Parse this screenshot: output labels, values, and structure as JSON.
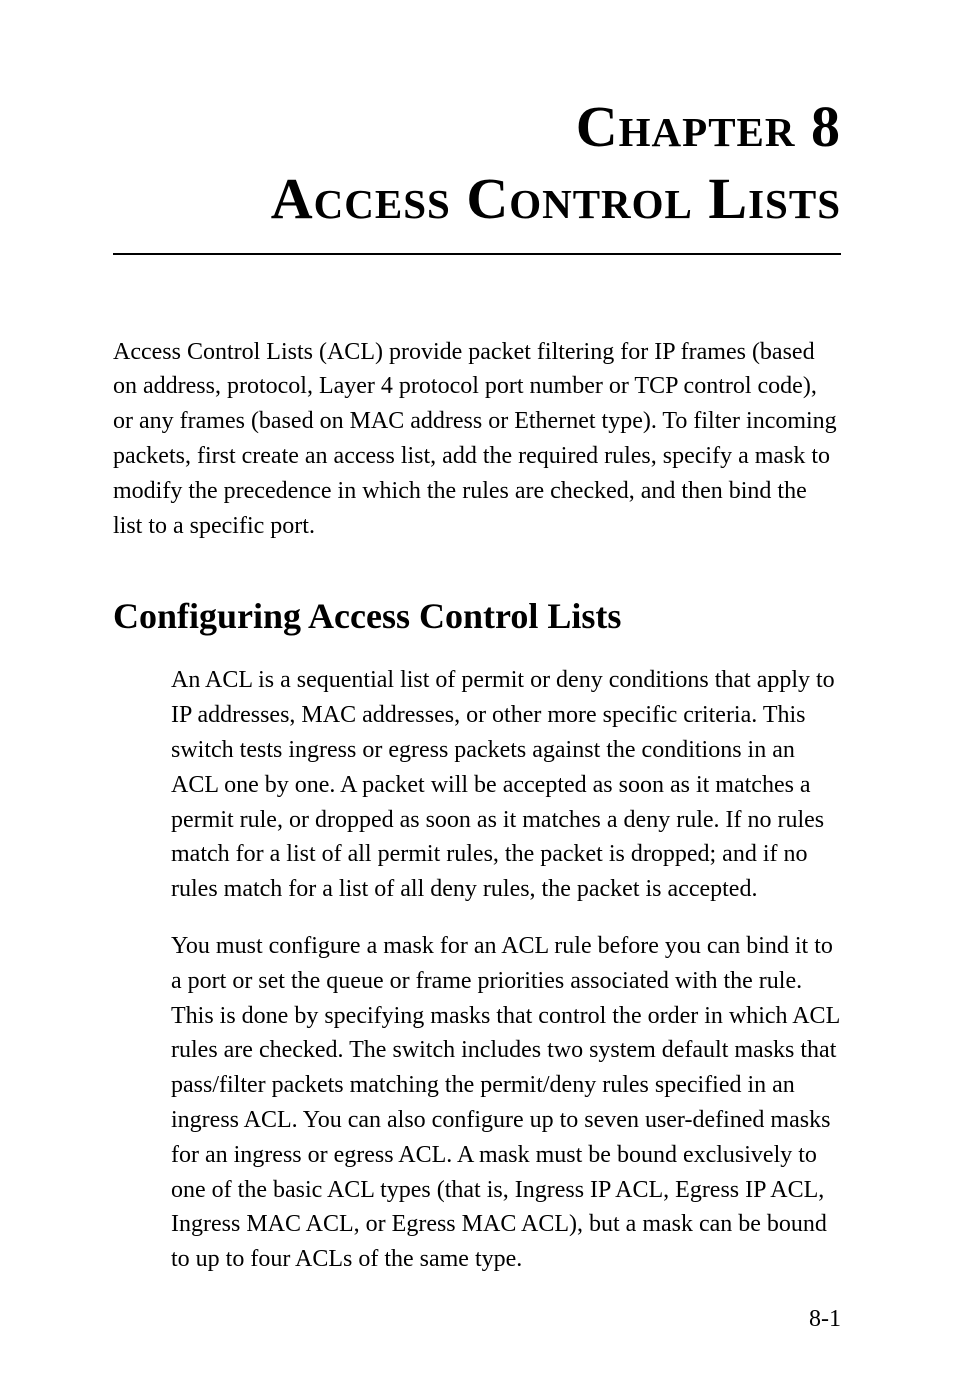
{
  "header": {
    "chapter_word": "Chapter",
    "chapter_number": "8",
    "chapter_title": "Access Control Lists"
  },
  "intro_paragraph": "Access Control Lists (ACL) provide packet filtering for IP frames (based on address, protocol, Layer 4 protocol port number or TCP control code), or any frames (based on MAC address or Ethernet type). To filter incoming packets, first create an access list, add the required rules, specify a mask to modify the precedence in which the rules are checked, and then bind the list to a specific port.",
  "section": {
    "heading": "Configuring Access Control Lists",
    "paragraphs": [
      "An ACL is a sequential list of permit or deny conditions that apply to IP addresses, MAC addresses, or other more specific criteria. This switch tests ingress or egress packets against the conditions in an ACL one by one. A packet will be accepted as soon as it matches a permit rule, or dropped as soon as it matches a deny rule. If no rules match for a list of all permit rules, the packet is dropped; and if no rules match for a list of all deny rules, the packet is accepted.",
      "You must configure a mask for an ACL rule before you can bind it to a port or set the queue or frame priorities associated with the rule. This is done by specifying masks that control the order in which ACL rules are checked. The switch includes two system default masks that pass/filter packets matching the permit/deny rules specified in an ingress ACL. You can also configure up to seven user-defined masks for an ingress or egress ACL. A mask must be bound exclusively to one of the basic ACL types (that is, Ingress IP ACL, Egress IP ACL, Ingress MAC ACL, or Egress MAC ACL), but a mask can be bound to up to four ACLs of the same type."
    ]
  },
  "page_number": "8-1"
}
